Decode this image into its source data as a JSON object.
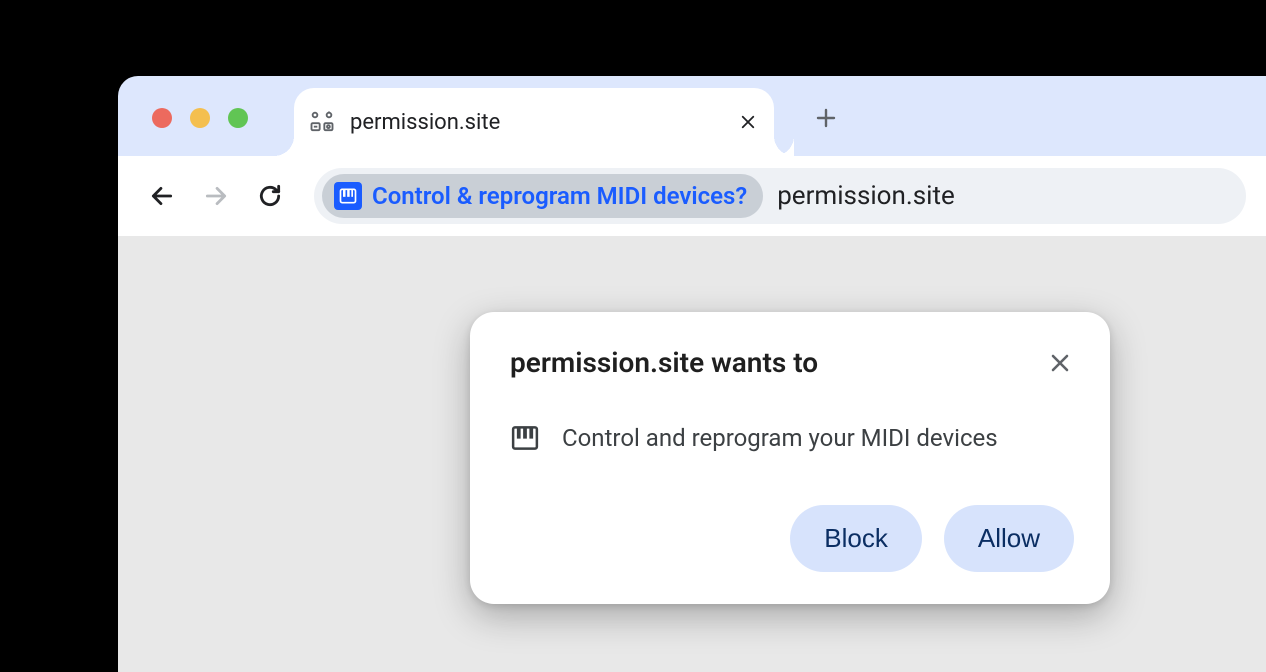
{
  "tab": {
    "title": "permission.site"
  },
  "omnibox": {
    "chip_text": "Control & reprogram MIDI devices?",
    "url": "permission.site"
  },
  "permission_prompt": {
    "title": "permission.site wants to",
    "body": "Control and reprogram your MIDI devices",
    "block_label": "Block",
    "allow_label": "Allow"
  }
}
